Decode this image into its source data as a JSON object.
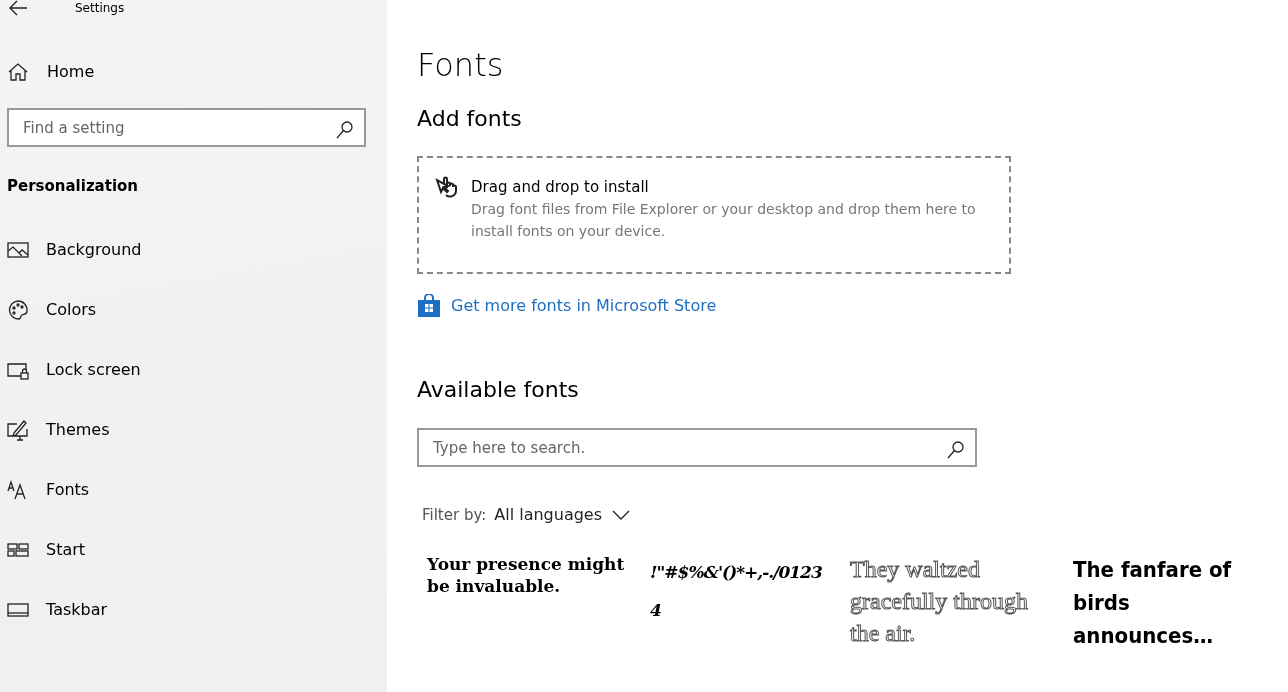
{
  "window": {
    "title": "Settings"
  },
  "sidebar": {
    "home": "Home",
    "search": {
      "placeholder": "Find a setting"
    },
    "section": "Personalization",
    "items": [
      {
        "label": "Background",
        "kind": "picture"
      },
      {
        "label": "Colors",
        "kind": "palette"
      },
      {
        "label": "Lock screen",
        "kind": "lock"
      },
      {
        "label": "Themes",
        "kind": "brush"
      },
      {
        "label": "Fonts",
        "kind": "font"
      },
      {
        "label": "Start",
        "kind": "tiles"
      },
      {
        "label": "Taskbar",
        "kind": "bar"
      }
    ]
  },
  "main": {
    "title": "Fonts",
    "add_heading": "Add fonts",
    "drop": {
      "title": "Drag and drop to install",
      "text": "Drag font files from File Explorer or your desktop and drop them here to install fonts on your device."
    },
    "store_link": "Get more fonts in Microsoft Store",
    "available_heading": "Available fonts",
    "search": {
      "placeholder": "Type here to search."
    },
    "filter": {
      "label": "Filter by:",
      "value": "All languages"
    },
    "samples": [
      {
        "text": "Your presence might be invaluable.",
        "kind": "serif"
      },
      {
        "text": "!\"#$%&'()*+,-./01234",
        "kind": "script"
      },
      {
        "text": "They waltzed gracefully through the air.",
        "kind": "outline"
      },
      {
        "text": "The fanfare of birds announces…",
        "kind": "heavy"
      }
    ]
  }
}
